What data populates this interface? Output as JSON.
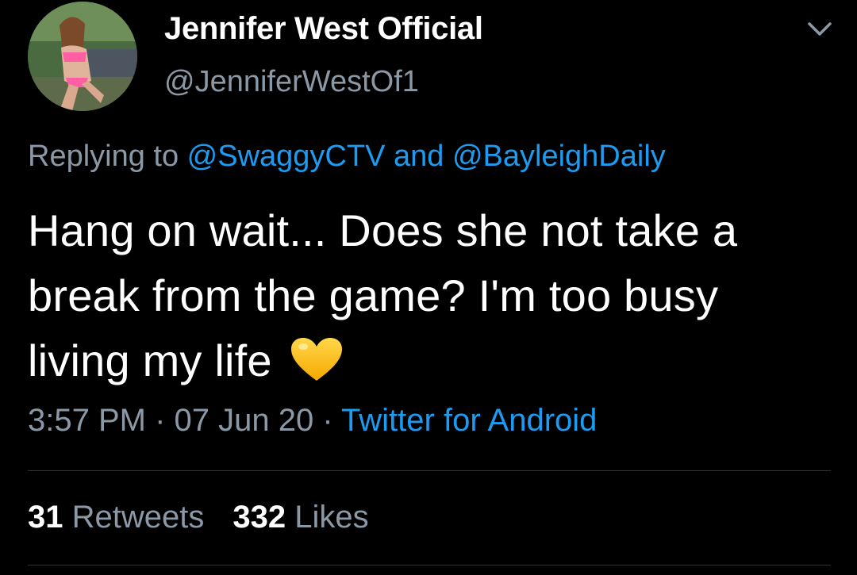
{
  "author": {
    "display_name": "Jennifer West Official",
    "handle": "@JenniferWestOf1",
    "avatar_icon": "profile-photo"
  },
  "menu": {
    "icon": "chevron-down-icon"
  },
  "reply": {
    "prefix": "Replying to ",
    "user1": "@SwaggyCTV",
    "conjunction": " and ",
    "user2": "@BayleighDaily"
  },
  "tweet": {
    "text": "Hang on wait... Does she not take a break from the game? I'm too busy living my life",
    "emoji": "yellow-heart-icon"
  },
  "meta": {
    "time": "3:57 PM",
    "separator": " · ",
    "date": "07 Jun 20",
    "source": "Twitter for Android"
  },
  "stats": {
    "retweets_count": "31",
    "retweets_label": "Retweets",
    "likes_count": "332",
    "likes_label": "Likes"
  },
  "colors": {
    "background": "#000000",
    "text_primary": "#ffffff",
    "text_secondary": "#8b98a5",
    "link": "#1d9bf0",
    "divider": "#2f3336",
    "heart": "#ffc61a"
  }
}
